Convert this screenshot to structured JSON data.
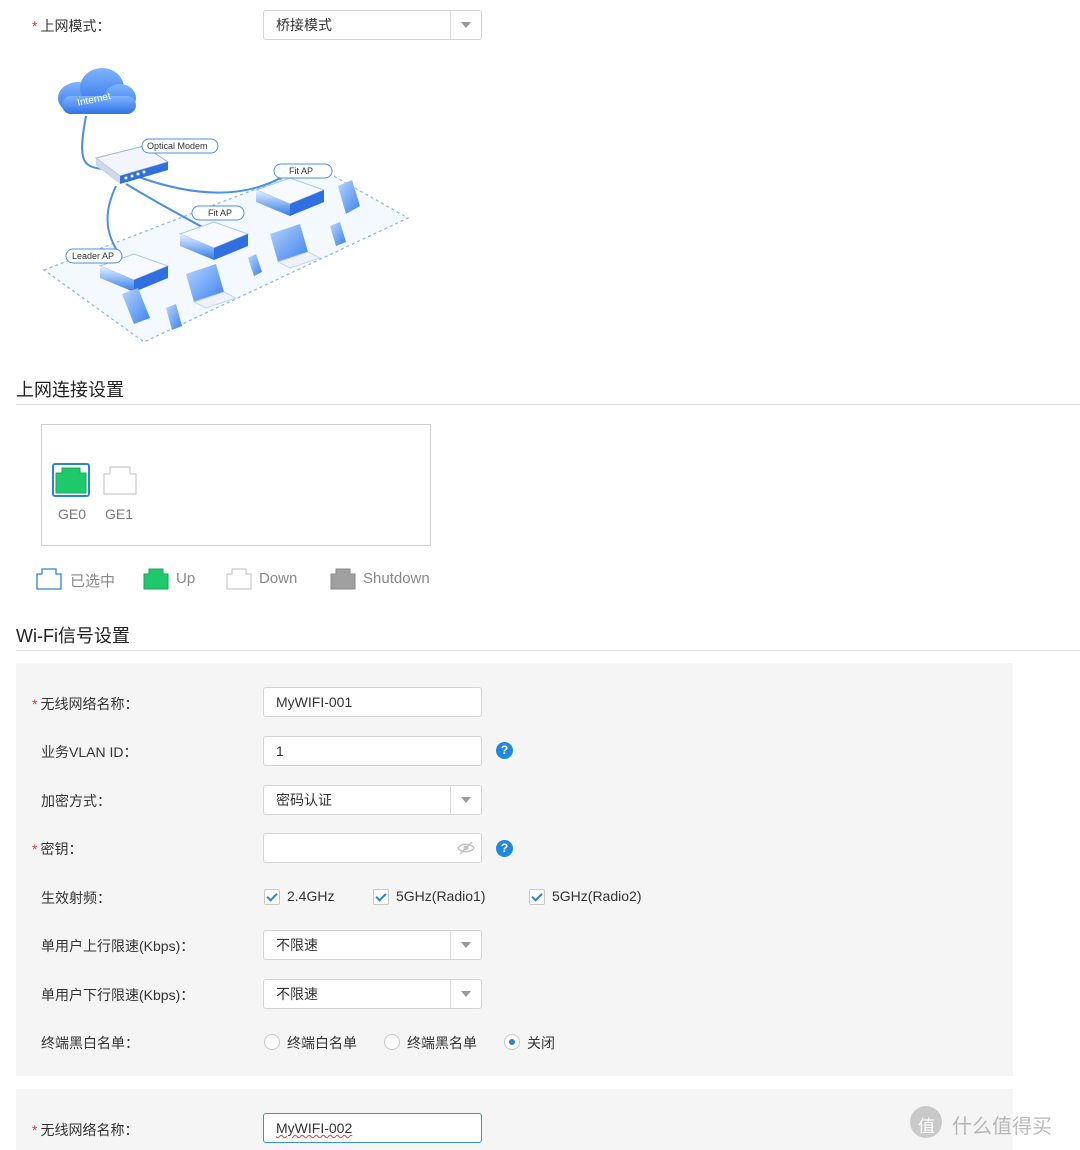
{
  "mode": {
    "label": "上网模式：",
    "value": "桥接模式"
  },
  "topology": {
    "internet": "Internet",
    "modem": "Optical Modem",
    "fit_ap_1": "Fit AP",
    "fit_ap_2": "Fit AP",
    "leader_ap": "Leader AP"
  },
  "connection": {
    "title": "上网连接设置",
    "ports": [
      {
        "name": "GE0",
        "state": "up"
      },
      {
        "name": "GE1",
        "state": "down"
      }
    ],
    "legend": {
      "selected": "已选中",
      "up": "Up",
      "down": "Down",
      "shutdown": "Shutdown"
    }
  },
  "wifi": {
    "title": "Wi-Fi信号设置",
    "ssid_label": "无线网络名称：",
    "ssid_value": "MyWIFI-001",
    "vlan_label": "业务VLAN ID：",
    "vlan_value": "1",
    "encryption_label": "加密方式：",
    "encryption_value": "密码认证",
    "key_label": "密钥：",
    "key_value": "",
    "bands_label": "生效射频：",
    "bands": [
      "2.4GHz",
      "5GHz(Radio1)",
      "5GHz(Radio2)"
    ],
    "uplink_label": "单用户上行限速(Kbps)：",
    "uplink_value": "不限速",
    "downlink_label": "单用户下行限速(Kbps)：",
    "downlink_value": "不限速",
    "acl_label": "终端黑白名单：",
    "acl_options": [
      "终端白名单",
      "终端黑名单",
      "关闭"
    ],
    "acl_selected": "关闭",
    "ssid2_label": "无线网络名称：",
    "ssid2_value": "MyWIFI-002"
  },
  "watermark": "什么值得买",
  "colors": {
    "accent": "#1e88e5",
    "port_up": "#1ec96b",
    "port_shutdown": "#a0a0a0",
    "required": "#e53935"
  }
}
